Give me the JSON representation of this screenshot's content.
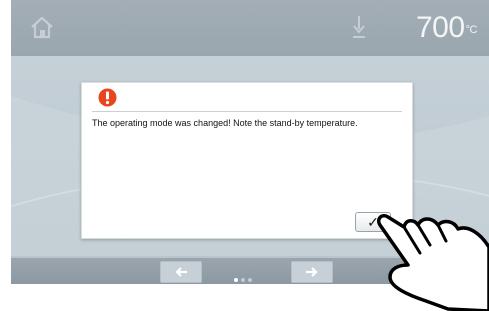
{
  "header": {
    "home_icon": "home-icon",
    "lower_icon": "arrow-down-icon",
    "temperature": "700",
    "temperature_unit": "°C"
  },
  "dialog": {
    "icon": "alert-icon",
    "message": "The operating mode was changed! Note the stand-by temperature.",
    "confirm_label": "✓"
  },
  "footer": {
    "prev_icon": "arrow-left-icon",
    "next_icon": "arrow-right-icon",
    "page_count": 3,
    "current_page": 1
  },
  "colors": {
    "alert": "#e8461e",
    "screen_background": "#c4cfd6",
    "bar": "#9aa6ae"
  }
}
